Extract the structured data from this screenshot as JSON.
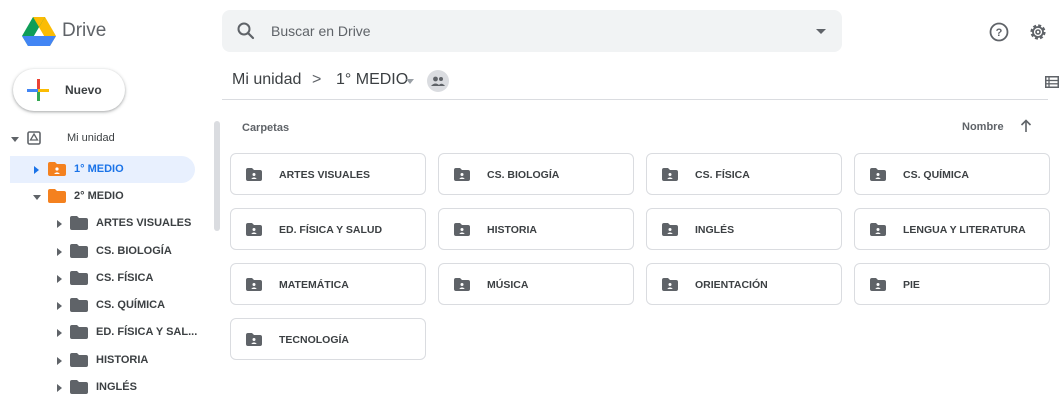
{
  "app": {
    "name": "Drive",
    "search_placeholder": "Buscar en Drive",
    "new_button": "Nuevo"
  },
  "colors": {
    "accent": "#1a73e8",
    "selected_bg": "#e8f0fe",
    "folder_orange": "#f4811f",
    "folder_gray": "#5f6368"
  },
  "sidebar": {
    "root": {
      "label": "Mi unidad",
      "icon": "drive-icon"
    },
    "items": [
      {
        "label": "1° MEDIO",
        "icon": "shared-folder-icon",
        "selected": true
      },
      {
        "label": "2° MEDIO",
        "icon": "folder-icon",
        "expanded": true
      },
      {
        "label": "ARTES VISUALES",
        "icon": "folder-icon"
      },
      {
        "label": "CS. BIOLOGÍA",
        "icon": "folder-icon"
      },
      {
        "label": "CS. FÍSICA",
        "icon": "folder-icon"
      },
      {
        "label": "CS. QUÍMICA",
        "icon": "folder-icon"
      },
      {
        "label": "ED. FÍSICA Y SAL...",
        "icon": "folder-icon"
      },
      {
        "label": "HISTORIA",
        "icon": "folder-icon"
      },
      {
        "label": "INGLÉS",
        "icon": "folder-icon"
      }
    ]
  },
  "breadcrumb": {
    "root": "Mi unidad",
    "separator": ">",
    "current": "1° MEDIO"
  },
  "main": {
    "section_label": "Carpetas",
    "sort_label": "Nombre",
    "folders": [
      "ARTES VISUALES",
      "CS. BIOLOGÍA",
      "CS. FÍSICA",
      "CS. QUÍMICA",
      "ED. FÍSICA Y SALUD",
      "HISTORIA",
      "INGLÉS",
      "LENGUA Y LITERATURA",
      "MATEMÁTICA",
      "MÚSICA",
      "ORIENTACIÓN",
      "PIE",
      "TECNOLOGÍA"
    ]
  }
}
